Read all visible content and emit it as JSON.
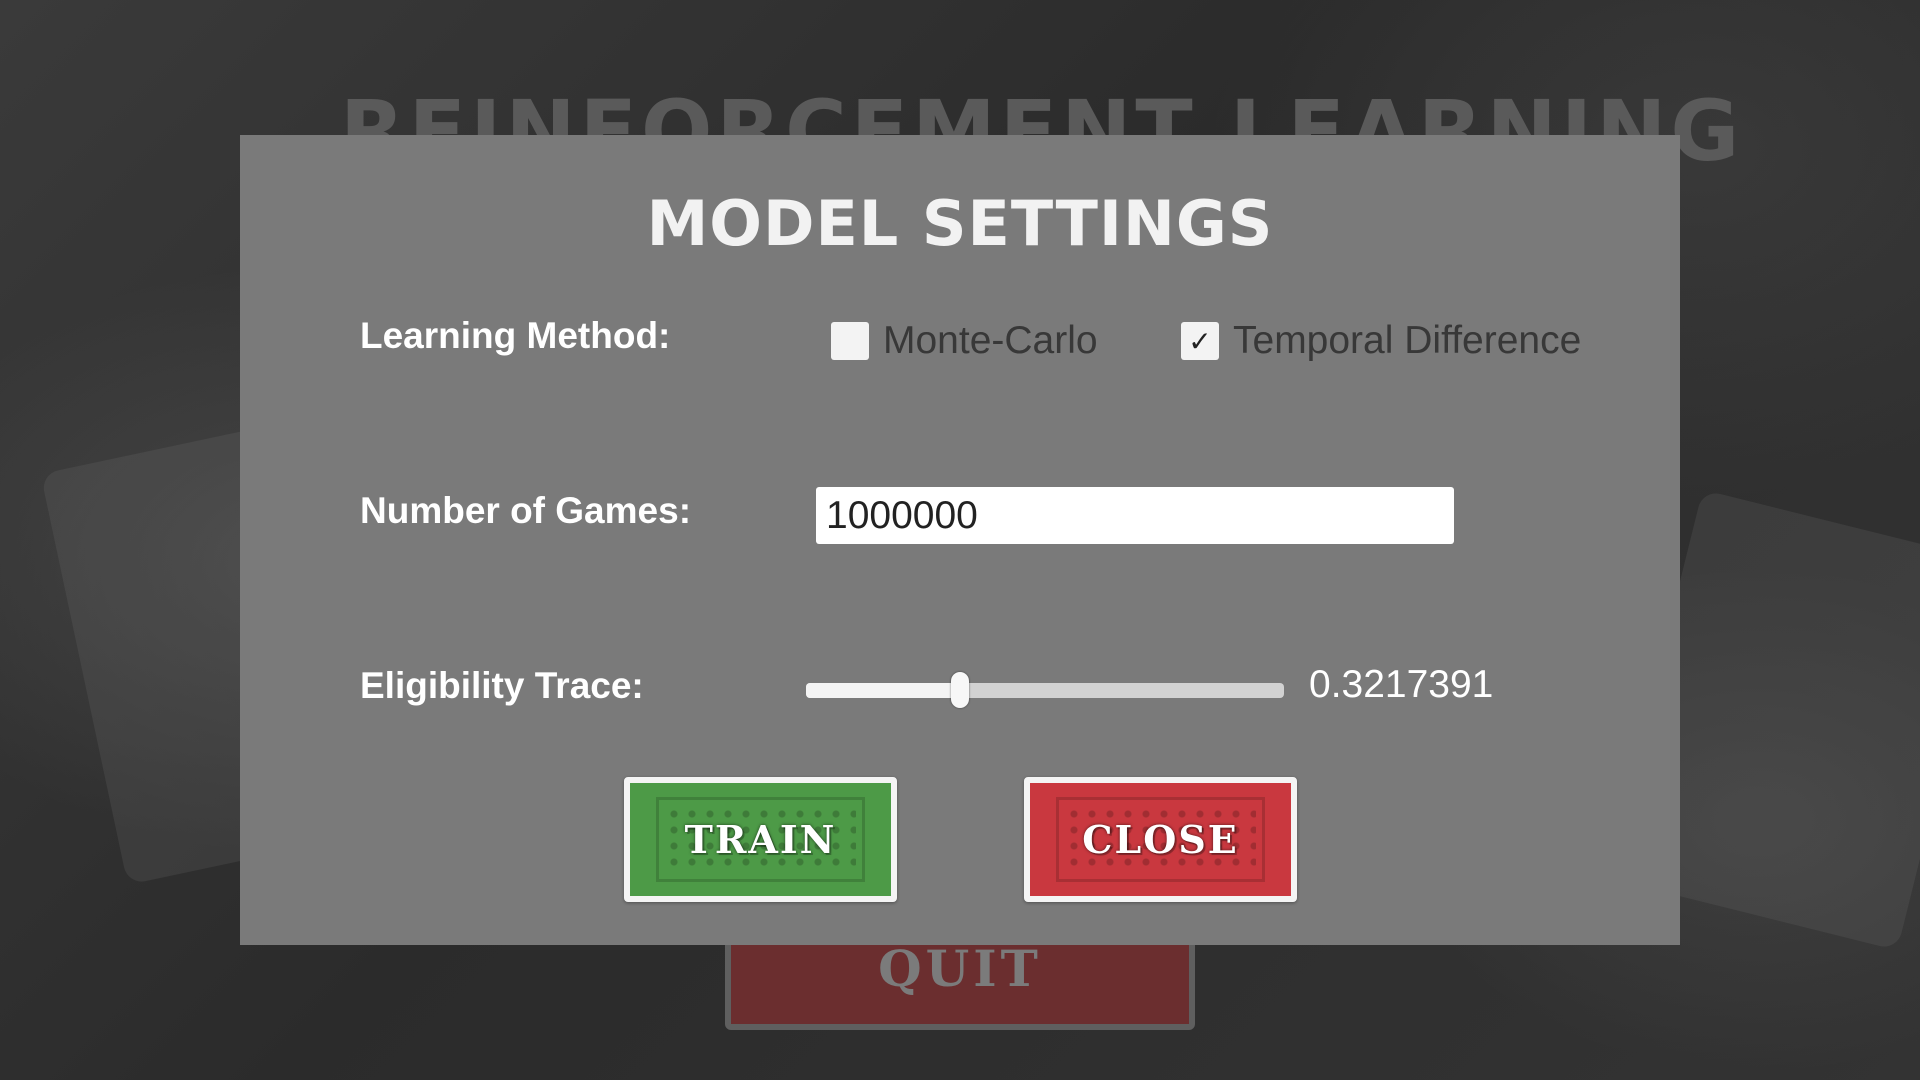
{
  "background": {
    "title": "REINFORCEMENT LEARNING",
    "quit_label": "QUIT"
  },
  "modal": {
    "title": "MODEL SETTINGS",
    "learning_method": {
      "label": "Learning Method:",
      "options": [
        {
          "label": "Monte-Carlo",
          "checked": false
        },
        {
          "label": "Temporal Difference",
          "checked": true
        }
      ]
    },
    "number_of_games": {
      "label": "Number of Games:",
      "value": "1000000"
    },
    "eligibility_trace": {
      "label": "Eligibility Trace:",
      "value": 0.3217391,
      "value_text": "0.3217391",
      "min": 0,
      "max": 1
    },
    "buttons": {
      "train_label": "TRAIN",
      "close_label": "CLOSE"
    }
  },
  "colors": {
    "modal_bg": "#7a7a7a",
    "train_green": "#4d9a47",
    "close_red": "#c9383f"
  },
  "icons": {
    "checkmark": "check-icon"
  }
}
